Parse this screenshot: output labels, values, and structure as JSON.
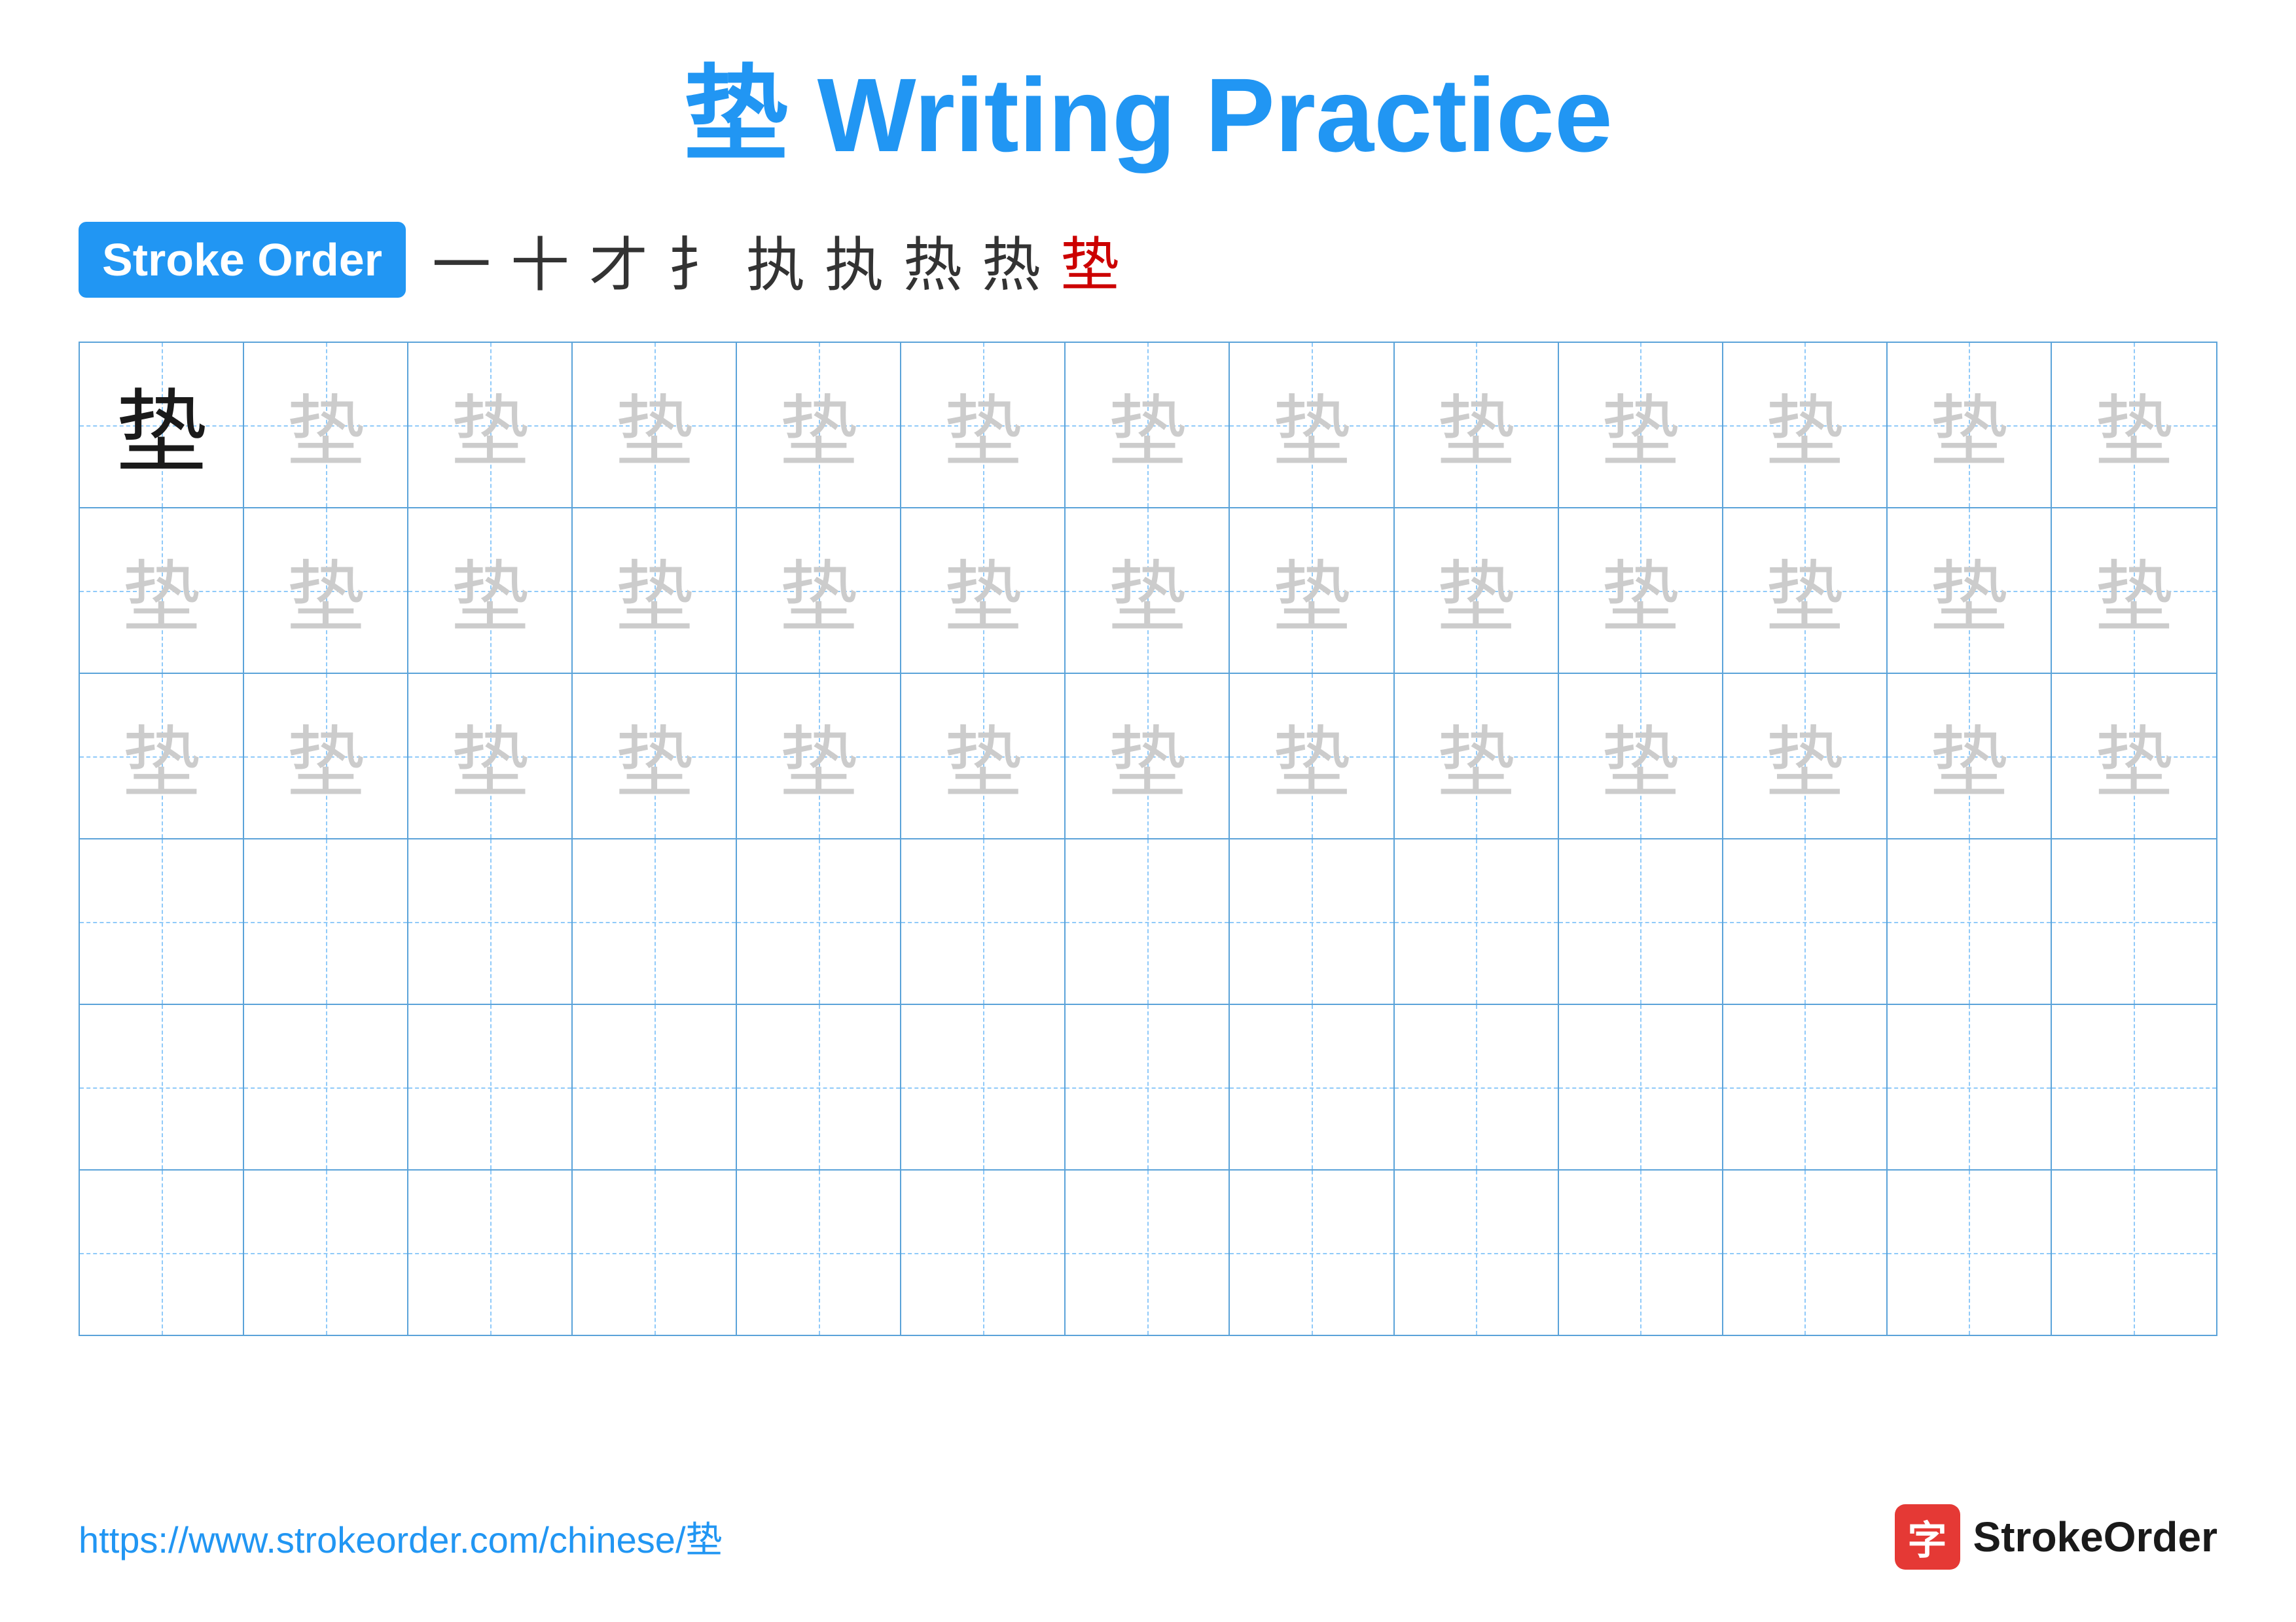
{
  "title": {
    "char": "垫",
    "label": "Writing Practice",
    "full": "垫 Writing Practice"
  },
  "stroke_order": {
    "badge": "Stroke Order",
    "strokes": [
      "一",
      "十",
      "才",
      "扌",
      "执",
      "执",
      "热",
      "热",
      "垫"
    ]
  },
  "grid": {
    "rows": 6,
    "cols": 13,
    "char": "垫",
    "row1_first_dark": true,
    "filled_rows": 3,
    "empty_rows": 3
  },
  "footer": {
    "url": "https://www.strokeorder.com/chinese/垫",
    "logo_char": "字",
    "logo_name": "StrokeOrder"
  },
  "colors": {
    "blue": "#2196F3",
    "red": "#cc0000",
    "dark": "#1a1a1a",
    "light_char": "#cccccc",
    "grid_border": "#5ba3d9",
    "grid_dash": "#90caf9"
  }
}
